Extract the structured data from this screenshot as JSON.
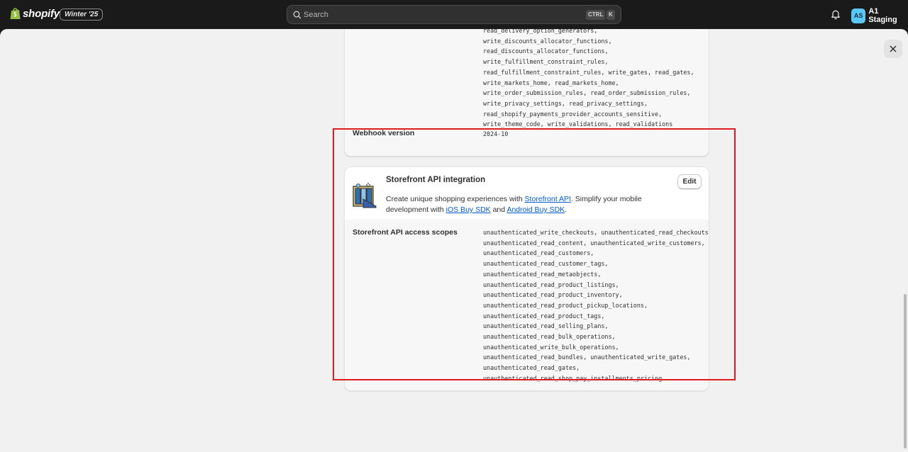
{
  "header": {
    "brand": "shopify",
    "edition": "Winter '25",
    "search": {
      "placeholder": "Search",
      "kbd_ctrl": "CTRL",
      "kbd_k": "K"
    },
    "account": {
      "initials": "AS",
      "name": "A1 Staging",
      "avatar_color": "#5ac6f4"
    }
  },
  "admin_api_card": {
    "scopes_text": "read_delivery_option_generators,\nwrite_discounts_allocator_functions,\nread_discounts_allocator_functions,\nwrite_fulfillment_constraint_rules,\nread_fulfillment_constraint_rules, write_gates, read_gates,\nwrite_markets_home, read_markets_home,\nwrite_order_submission_rules, read_order_submission_rules,\nwrite_privacy_settings, read_privacy_settings,\nread_shopify_payments_provider_accounts_sensitive,\nwrite_theme_code, write_validations, read_validations",
    "webhook_label": "Webhook version",
    "webhook_value": "2024-10"
  },
  "storefront_card": {
    "title": "Storefront API integration",
    "edit_label": "Edit",
    "desc_part1": "Create unique shopping experiences with ",
    "link_storefront": "Storefront API",
    "desc_part2": ". Simplify your mobile development with ",
    "link_ios": "iOS Buy SDK",
    "desc_part3": " and ",
    "link_android": "Android Buy SDK",
    "desc_part4": ".",
    "scopes_label": "Storefront API access scopes",
    "scopes_text": "unauthenticated_write_checkouts, unauthenticated_read_checkouts,\nunauthenticated_read_content, unauthenticated_write_customers,\nunauthenticated_read_customers,\nunauthenticated_read_customer_tags,\nunauthenticated_read_metaobjects,\nunauthenticated_read_product_listings,\nunauthenticated_read_product_inventory,\nunauthenticated_read_product_pickup_locations,\nunauthenticated_read_product_tags,\nunauthenticated_read_selling_plans,\nunauthenticated_read_bulk_operations,\nunauthenticated_write_bulk_operations,\nunauthenticated_read_bundles, unauthenticated_write_gates,\nunauthenticated_read_gates,\nunauthenticated_read_shop_pay_installments_pricing"
  },
  "colors": {
    "link": "#005bd3",
    "highlight": "#e01b24",
    "topbar": "#1a1a1a",
    "page_bg": "#f1f1f1"
  }
}
